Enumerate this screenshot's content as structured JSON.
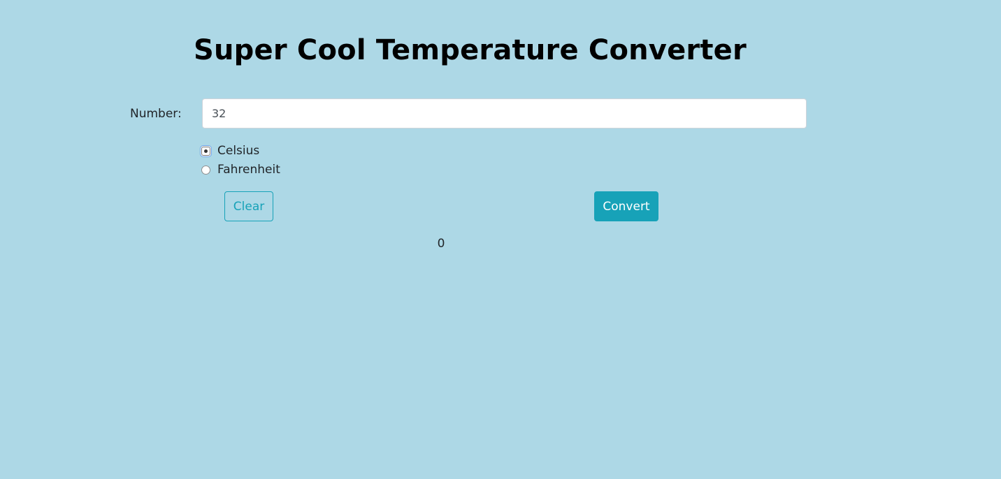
{
  "header": {
    "title": "Super Cool Temperature Converter"
  },
  "form": {
    "number_label": "Number:",
    "number_value": "32",
    "units": [
      {
        "label": "Celsius",
        "checked": true
      },
      {
        "label": "Fahrenheit",
        "checked": false
      }
    ],
    "clear_label": "Clear",
    "convert_label": "Convert"
  },
  "result": {
    "value": "0"
  },
  "colors": {
    "background": "#add8e6",
    "accent": "#17a2b8",
    "title": "#000000",
    "text": "#212529"
  }
}
